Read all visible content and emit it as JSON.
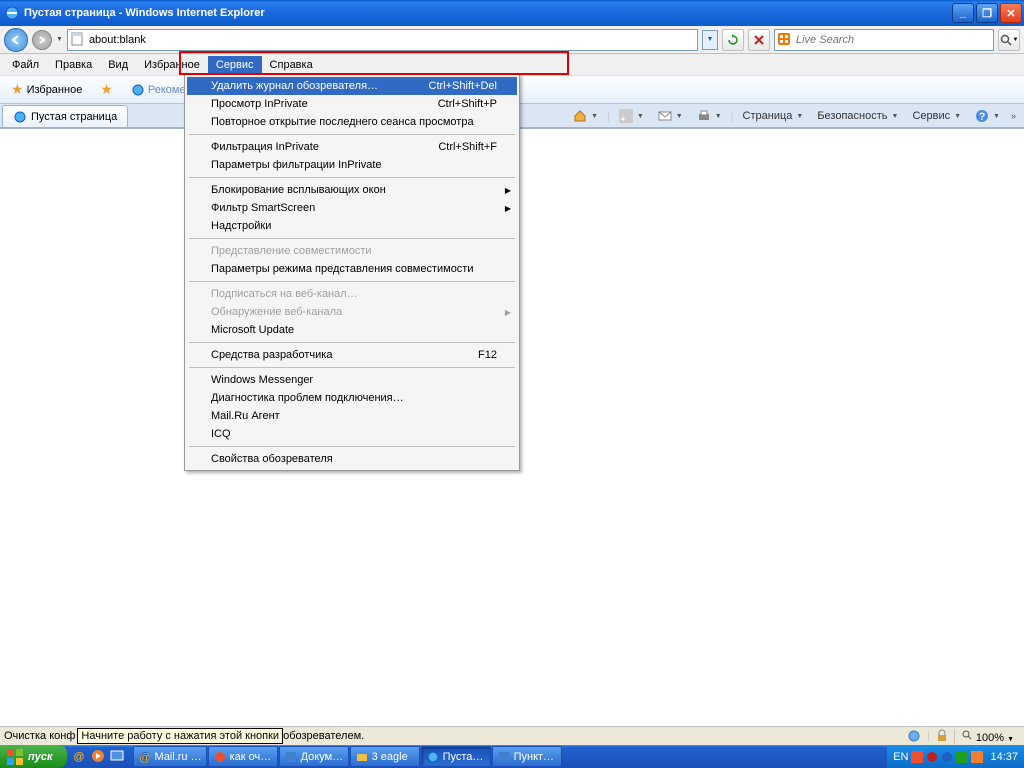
{
  "titlebar": {
    "title": "Пустая страница - Windows Internet Explorer"
  },
  "address": {
    "value": "about:blank"
  },
  "search": {
    "placeholder": "Live Search"
  },
  "menubar": [
    "Файл",
    "Правка",
    "Вид",
    "Избранное",
    "Сервис",
    "Справка"
  ],
  "active_menu_index": 4,
  "favbar": {
    "btn": "Избранное",
    "rec": "Рекомен..."
  },
  "tab": {
    "label": "Пустая страница"
  },
  "cmdbar": {
    "page": "Страница",
    "safety": "Безопасность",
    "tools": "Сервис"
  },
  "dropdown": [
    {
      "t": "item",
      "label": "Удалить журнал обозревателя…",
      "sc": "Ctrl+Shift+Del",
      "sel": true
    },
    {
      "t": "item",
      "label": "Просмотр InPrivate",
      "sc": "Ctrl+Shift+P"
    },
    {
      "t": "item",
      "label": "Повторное открытие последнего сеанса просмотра"
    },
    {
      "t": "sep"
    },
    {
      "t": "item",
      "label": "Фильтрация InPrivate",
      "sc": "Ctrl+Shift+F"
    },
    {
      "t": "item",
      "label": "Параметры фильтрации InPrivate"
    },
    {
      "t": "sep"
    },
    {
      "t": "item",
      "label": "Блокирование всплывающих окон",
      "sub": true
    },
    {
      "t": "item",
      "label": "Фильтр SmartScreen",
      "sub": true
    },
    {
      "t": "item",
      "label": "Надстройки"
    },
    {
      "t": "sep"
    },
    {
      "t": "item",
      "label": "Представление совместимости",
      "disabled": true
    },
    {
      "t": "item",
      "label": "Параметры режима представления совместимости"
    },
    {
      "t": "sep"
    },
    {
      "t": "item",
      "label": "Подписаться на веб-канал…",
      "disabled": true
    },
    {
      "t": "item",
      "label": "Обнаружение веб-канала",
      "disabled": true,
      "sub": true
    },
    {
      "t": "item",
      "label": "Microsoft Update"
    },
    {
      "t": "sep"
    },
    {
      "t": "item",
      "label": "Средства разработчика",
      "sc": "F12"
    },
    {
      "t": "sep"
    },
    {
      "t": "item",
      "label": "Windows Messenger"
    },
    {
      "t": "item",
      "label": "Диагностика проблем подключения…"
    },
    {
      "t": "item",
      "label": "Mail.Ru Агент"
    },
    {
      "t": "item",
      "label": "ICQ"
    },
    {
      "t": "sep"
    },
    {
      "t": "item",
      "label": "Свойства обозревателя"
    }
  ],
  "status": {
    "left": "Очистка конф",
    "tip": "Начните работу с нажатия этой кнопки",
    "right": "обозревателем.",
    "zoom": "100%"
  },
  "taskbar": {
    "start": "пуск",
    "tasks": [
      "Mail.ru …",
      "как оч…",
      "Докум…",
      "3 eagle",
      "Пуста…",
      "Пункт…"
    ],
    "active_task": 4,
    "lang": "EN",
    "clock": "14:37"
  }
}
